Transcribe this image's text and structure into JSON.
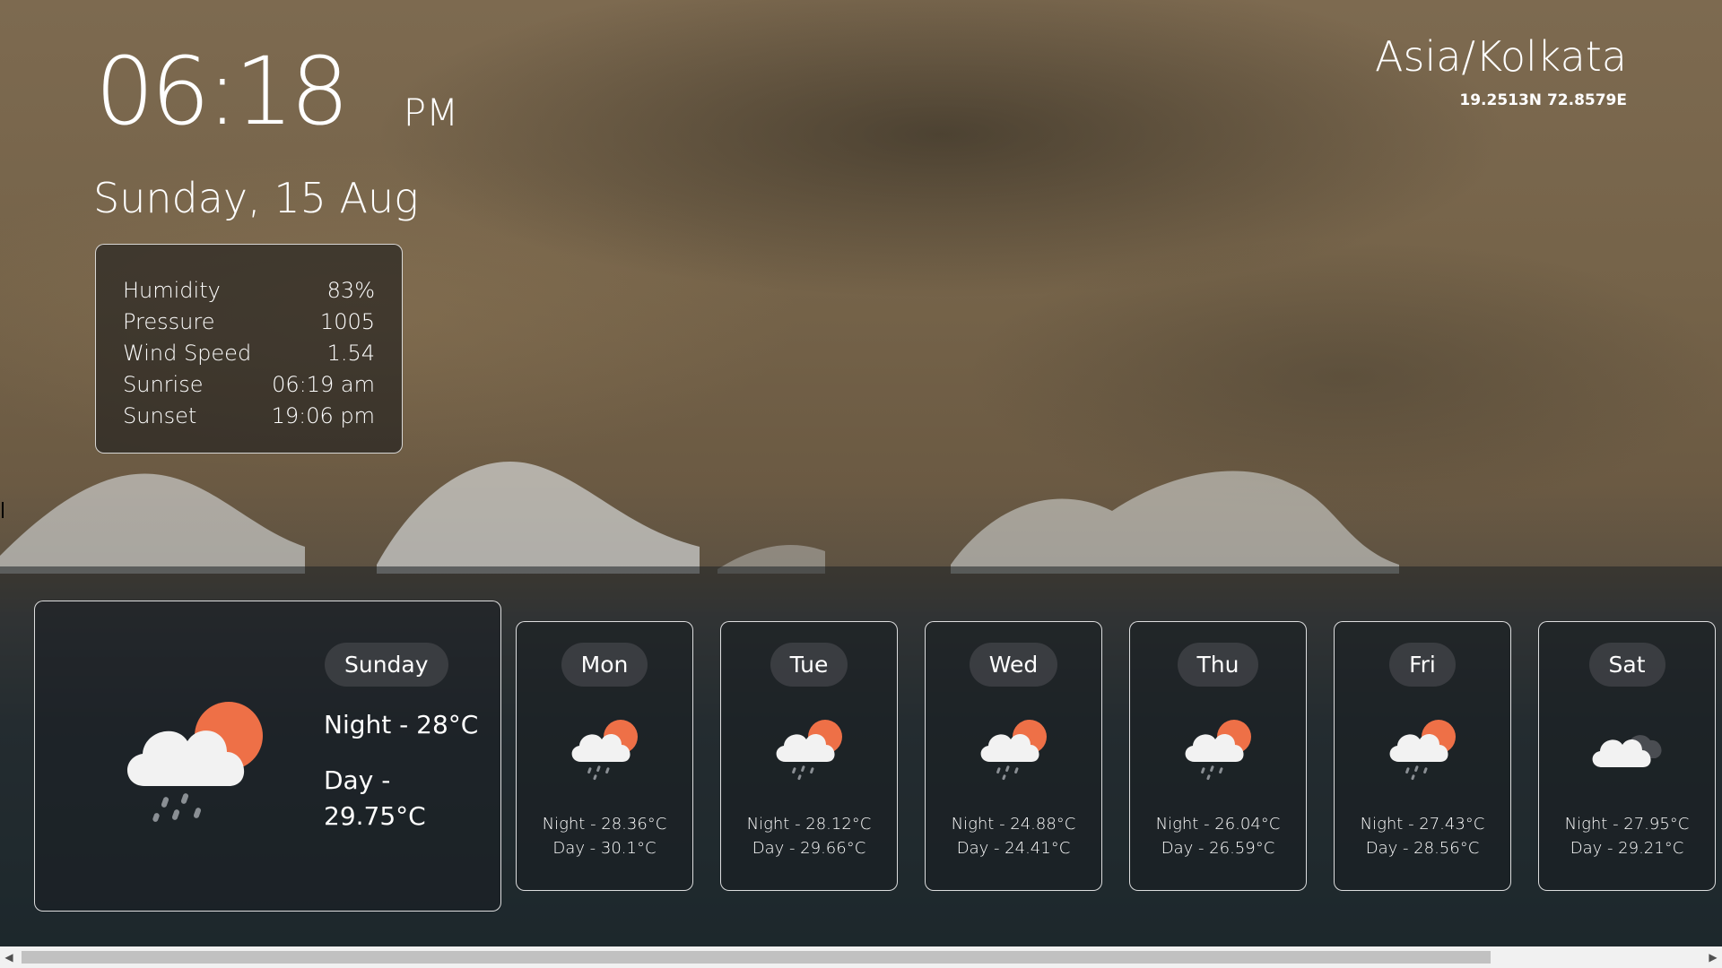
{
  "clock": {
    "time": "06:18",
    "ampm": "PM"
  },
  "date": "Sunday, 15 Aug",
  "details": [
    {
      "label": "Humidity",
      "value": "83%"
    },
    {
      "label": "Pressure",
      "value": "1005"
    },
    {
      "label": "Wind Speed",
      "value": "1.54"
    },
    {
      "label": "Sunrise",
      "value": "06:19 am"
    },
    {
      "label": "Sunset",
      "value": "19:06 pm"
    }
  ],
  "location": {
    "timezone": "Asia/Kolkata",
    "coords": "19.2513N 72.8579E"
  },
  "today": {
    "day": "Sunday",
    "night": "Night - 28°C",
    "day_temp": "Day - 29.75°C",
    "icon": "rain-cloud-sun-icon"
  },
  "forecast": [
    {
      "day": "Mon",
      "night": "Night - 28.36°C",
      "day_temp": "Day - 30.1°C",
      "icon": "rain-cloud-sun-icon"
    },
    {
      "day": "Tue",
      "night": "Night - 28.12°C",
      "day_temp": "Day - 29.66°C",
      "icon": "rain-cloud-sun-icon"
    },
    {
      "day": "Wed",
      "night": "Night - 24.88°C",
      "day_temp": "Day - 24.41°C",
      "icon": "rain-cloud-sun-icon"
    },
    {
      "day": "Thu",
      "night": "Night - 26.04°C",
      "day_temp": "Day - 26.59°C",
      "icon": "rain-cloud-sun-icon"
    },
    {
      "day": "Fri",
      "night": "Night - 27.43°C",
      "day_temp": "Day - 28.56°C",
      "icon": "rain-cloud-sun-icon"
    },
    {
      "day": "Sat",
      "night": "Night - 27.95°C",
      "day_temp": "Day - 29.21°C",
      "icon": "overcast-clouds-icon"
    }
  ],
  "colors": {
    "sun": "#ee7047",
    "cloud": "#f2f2f2",
    "rain": "#8a8f94",
    "pill": "#3c3e42"
  }
}
